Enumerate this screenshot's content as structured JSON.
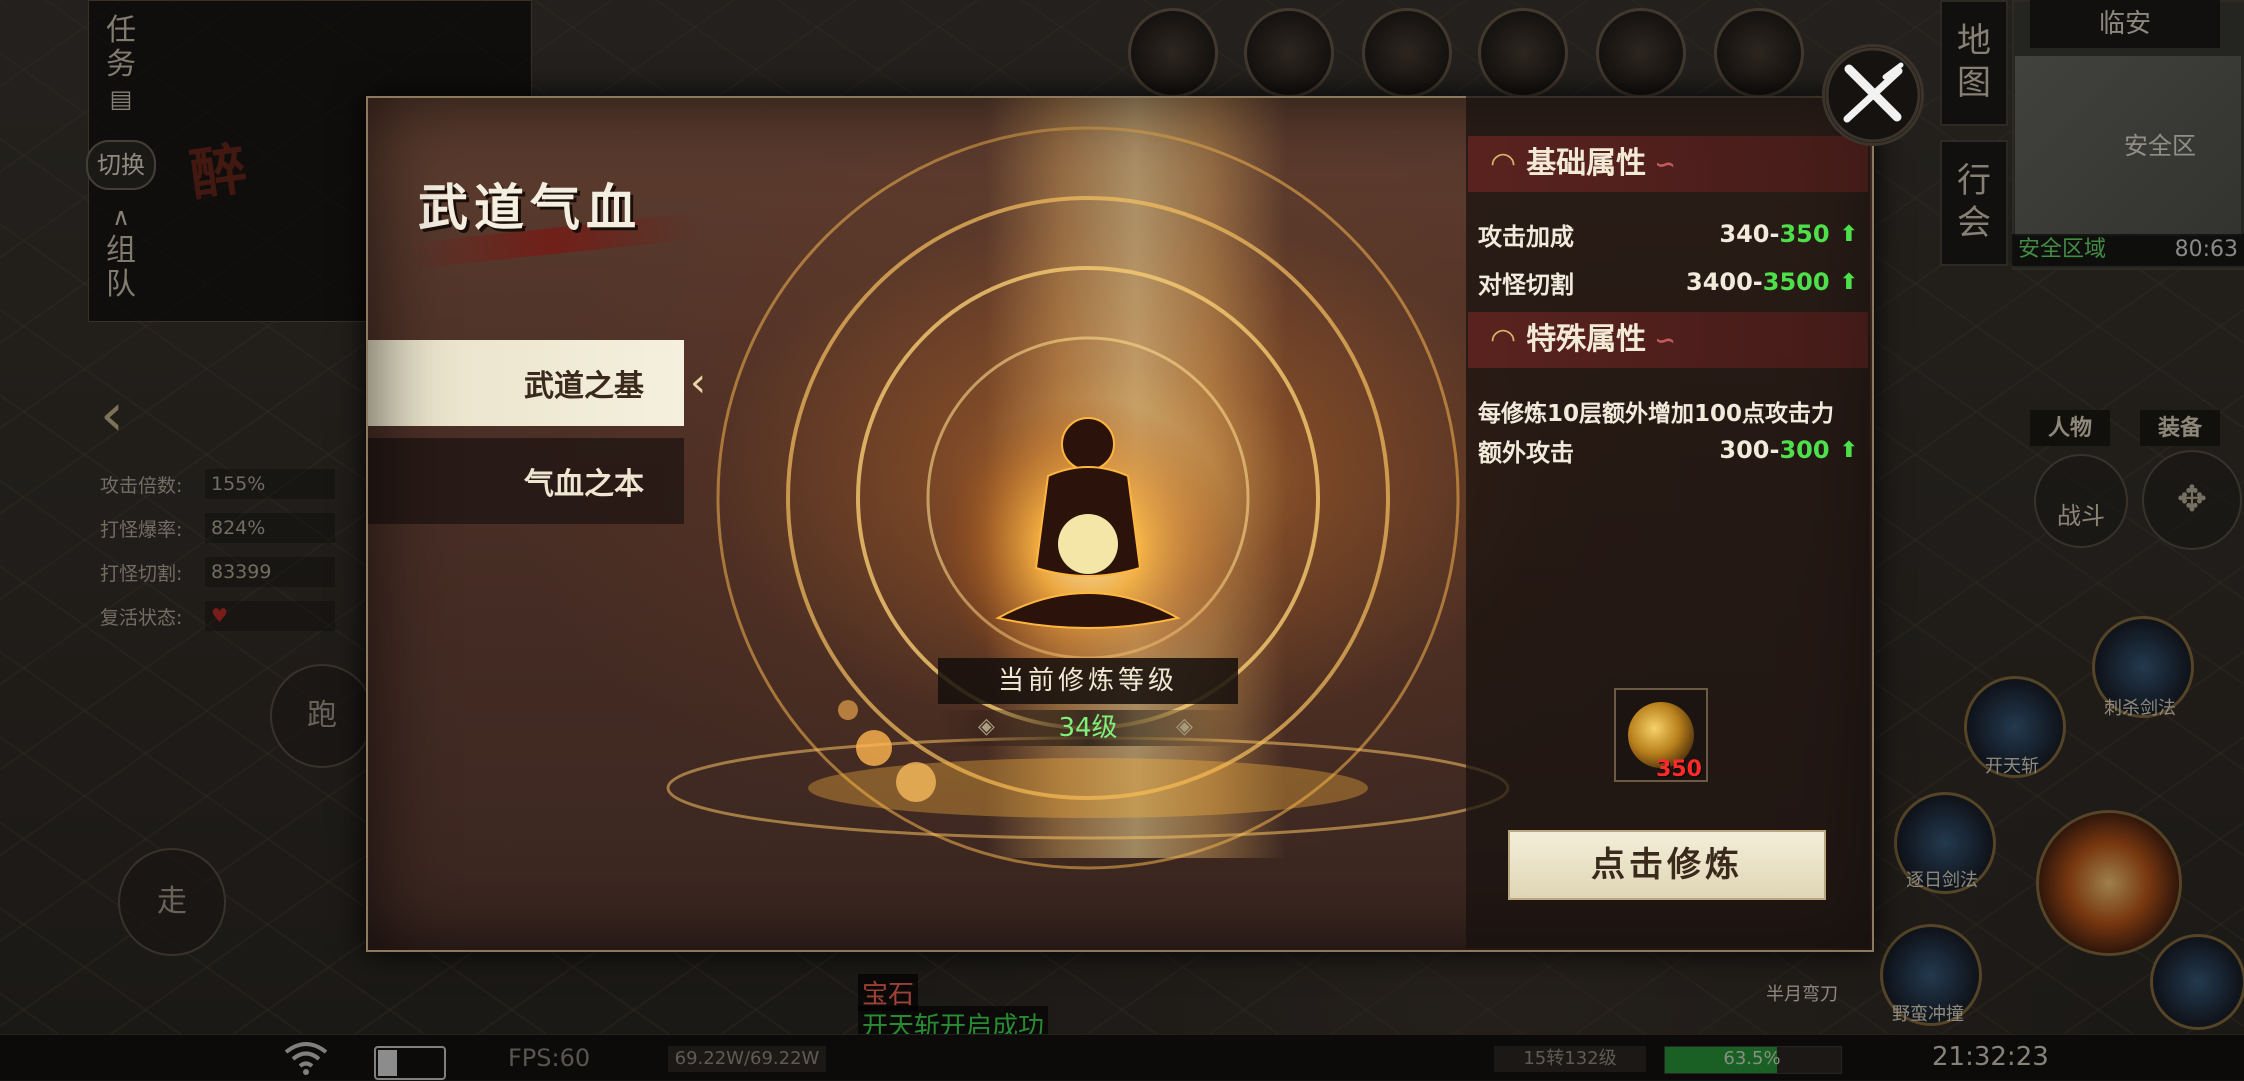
{
  "hud": {
    "left_tabs": {
      "task": "任务",
      "switch": "切换",
      "team": "组队"
    },
    "logo_text": "醉",
    "stats": [
      {
        "label": "攻击倍数:",
        "value": "155%"
      },
      {
        "label": "打怪爆率:",
        "value": "824%"
      },
      {
        "label": "打怪切割:",
        "value": "83399"
      },
      {
        "label": "复活状态:",
        "value": ""
      }
    ],
    "run_label": "跑",
    "walk_label": "走",
    "map_tabs": {
      "map": "地图",
      "guild": "行会"
    },
    "minimap": {
      "title": "临安",
      "safe_zone": "安全区",
      "area_name": "安全区域",
      "coords": "80:63"
    },
    "char_buttons": {
      "character": "人物",
      "equipment": "装备"
    },
    "battle_label": "战斗",
    "skills": [
      {
        "name": "开天斩"
      },
      {
        "name": "逐日剑法"
      },
      {
        "name": "半月弯刀"
      },
      {
        "name": "野蛮冲撞"
      },
      {
        "name": "刺杀剑法"
      }
    ],
    "chat": {
      "line1": "宝石",
      "line2": "开天斩开启成功"
    },
    "bottom": {
      "fps": "FPS:60",
      "hp": "69.22W/69.22W",
      "level": "15转132级",
      "exp_percent": 63.5,
      "exp_text": "63.5%",
      "time": "21:32:23",
      "battery_level": 0.3
    }
  },
  "modal": {
    "title": "武道气血",
    "tabs": [
      {
        "label": "武道之基",
        "active": true
      },
      {
        "label": "气血之本",
        "active": false
      }
    ],
    "level_label": "当前修炼等级",
    "level_value": "34级",
    "basic_header": "基础属性",
    "basic_attrs": [
      {
        "name": "攻击加成",
        "base": "340",
        "next": "350"
      },
      {
        "name": "对怪切割",
        "base": "3400",
        "next": "3500"
      }
    ],
    "special_header": "特殊属性",
    "special_desc": "每修炼10层额外增加100点攻击力",
    "special_attrs": [
      {
        "name": "额外攻击",
        "base": "300",
        "next": "300"
      }
    ],
    "material_count": "350",
    "train_button": "点击修炼"
  },
  "colors": {
    "accent_green": "#4ee04a",
    "accent_red": "#ff2a2a",
    "header_bg": "#5f2320"
  },
  "icons": [
    "close-icon",
    "fan-icon",
    "up-arrow-icon",
    "wifi-icon",
    "battery-icon",
    "heart-icon"
  ]
}
